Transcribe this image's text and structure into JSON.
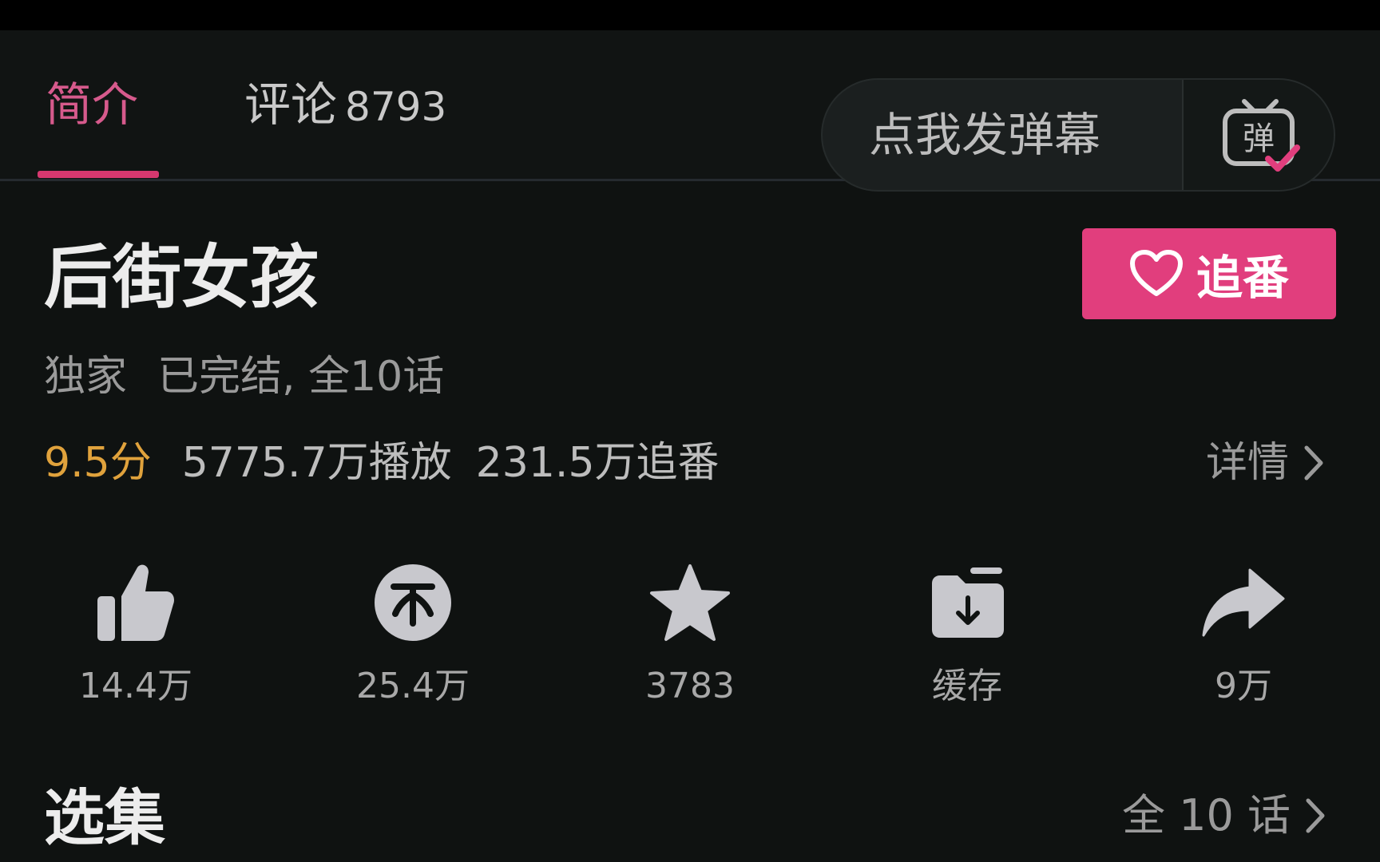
{
  "tabs": {
    "intro": "简介",
    "comments": "评论",
    "comments_count": "8793"
  },
  "danmaku": {
    "placeholder": "点我发弹幕",
    "toggle_icon": "danmaku-tv-icon",
    "toggle_glyph": "弹"
  },
  "show": {
    "title": "后街女孩",
    "tag": "独家",
    "status": "已完结, 全10话",
    "score": "9.5分",
    "plays": "5775.7万播放",
    "follows": "231.5万追番",
    "details": "详情"
  },
  "follow_button": {
    "label": "追番",
    "icon": "heart-outline-icon"
  },
  "actions": [
    {
      "icon": "thumbs-up-icon",
      "label": "14.4万"
    },
    {
      "icon": "coin-icon",
      "label": "25.4万"
    },
    {
      "icon": "star-icon",
      "label": "3783"
    },
    {
      "icon": "download-folder-icon",
      "label": "缓存"
    },
    {
      "icon": "share-arrow-icon",
      "label": "9万"
    }
  ],
  "episodes": {
    "title": "选集",
    "link": "全 10 话"
  },
  "colors": {
    "accent_pink": "#e13e7d",
    "tab_active": "#d65a8c",
    "score_orange": "#e0a23c",
    "background": "#0f1211"
  }
}
